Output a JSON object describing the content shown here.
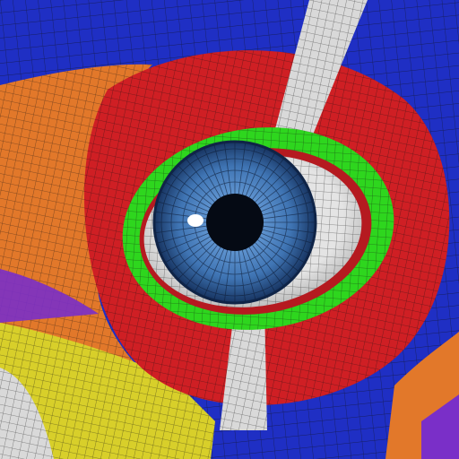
{
  "scene": {
    "subject": "eye-topology-mesh",
    "colors": {
      "blue": "#1f2fc4",
      "orange": "#e2782a",
      "red": "#cf1f24",
      "green": "#2ed61e",
      "white": "#d9d9d9",
      "yellow": "#d8cf2a",
      "purple": "#7a2fc8",
      "iris_outer": "#1d3f7a",
      "iris_inner": "#4f86c6",
      "pupil": "#050a14",
      "wire": "#111111"
    }
  }
}
